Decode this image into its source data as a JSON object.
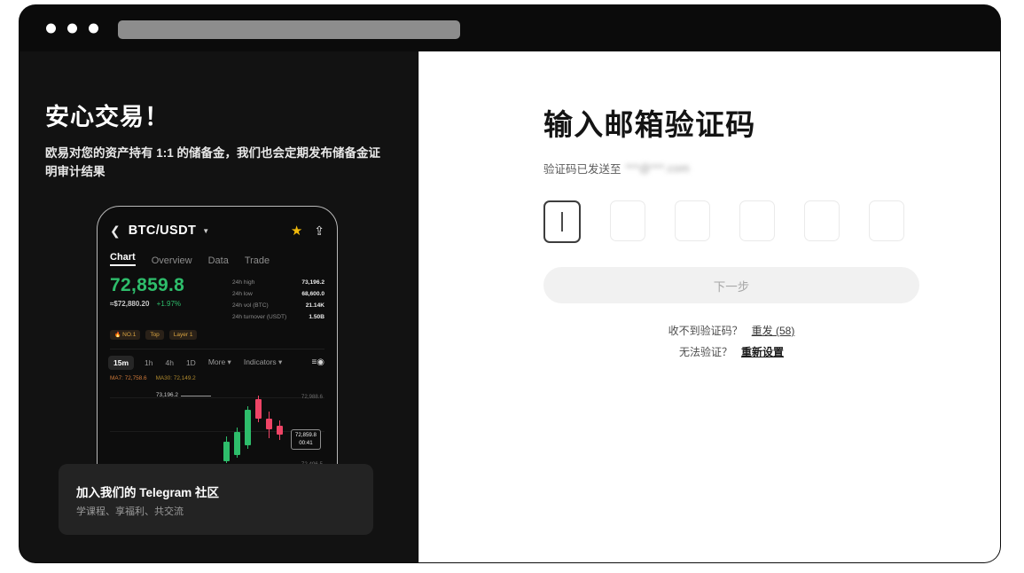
{
  "browser": {
    "traffic_lights": [
      "close",
      "minimize",
      "maximize"
    ],
    "address_bar_placeholder": ""
  },
  "left_panel": {
    "headline": "安心交易！",
    "body": "欧易对您的资产持有 1:1 的储备金，我们也会定期发布储备金证明审计结果",
    "phone": {
      "back_icon": "chevron-left-icon",
      "pair": "BTC/USDT",
      "caret_icon": "chevron-down-icon",
      "star_icon": "star-icon",
      "share_icon": "share-icon",
      "tabs": [
        {
          "label": "Chart",
          "active": true
        },
        {
          "label": "Overview",
          "active": false
        },
        {
          "label": "Data",
          "active": false
        },
        {
          "label": "Trade",
          "active": false
        }
      ],
      "price": "72,859.8",
      "price_usd": "≈$72,880.20",
      "price_change": "+1.97%",
      "stats": [
        {
          "key": "24h high",
          "value": "73,196.2"
        },
        {
          "key": "24h low",
          "value": "68,600.0"
        },
        {
          "key": "24h vol (BTC)",
          "value": "21.14K"
        },
        {
          "key": "24h turnover (USDT)",
          "value": "1.50B"
        }
      ],
      "tags": [
        "NO.1",
        "Top",
        "Layer 1"
      ],
      "timeframes": [
        {
          "label": "15m",
          "active": true
        },
        {
          "label": "1h",
          "active": false
        },
        {
          "label": "4h",
          "active": false
        },
        {
          "label": "1D",
          "active": false
        },
        {
          "label": "More ▾",
          "active": false
        },
        {
          "label": "Indicators ▾",
          "active": false
        }
      ],
      "settings_icon": "chart-settings-icon",
      "ma7": "MA7: 72,758.6",
      "ma30": "MA30: 72,149.2",
      "chart_high_label": "73,196.2",
      "axis_top": "72,988.6",
      "axis_bottom": "72,496.5",
      "marker_price": "72,859.8",
      "marker_time": "00:41"
    },
    "telegram_card": {
      "title": "加入我们的 Telegram 社区",
      "subtitle": "学课程、享福利、共交流"
    }
  },
  "right_panel": {
    "title": "输入邮箱验证码",
    "subtitle_prefix": "验证码已发送至",
    "email_masked": "***@***.com",
    "otp": {
      "length": 6,
      "values": [
        "",
        "",
        "",
        "",
        "",
        ""
      ],
      "focused_index": 0
    },
    "next_button": "下一步",
    "helper": {
      "resend_prefix": "收不到验证码？",
      "resend_link": "重发 (58)",
      "reset_prefix": "无法验证？",
      "reset_link": "重新设置"
    }
  },
  "colors": {
    "dark_bg": "#121212",
    "accent_green": "#2ebd6b",
    "accent_red": "#ef4466",
    "star_gold": "#f0b90b",
    "button_disabled_bg": "#f1f1f1"
  }
}
